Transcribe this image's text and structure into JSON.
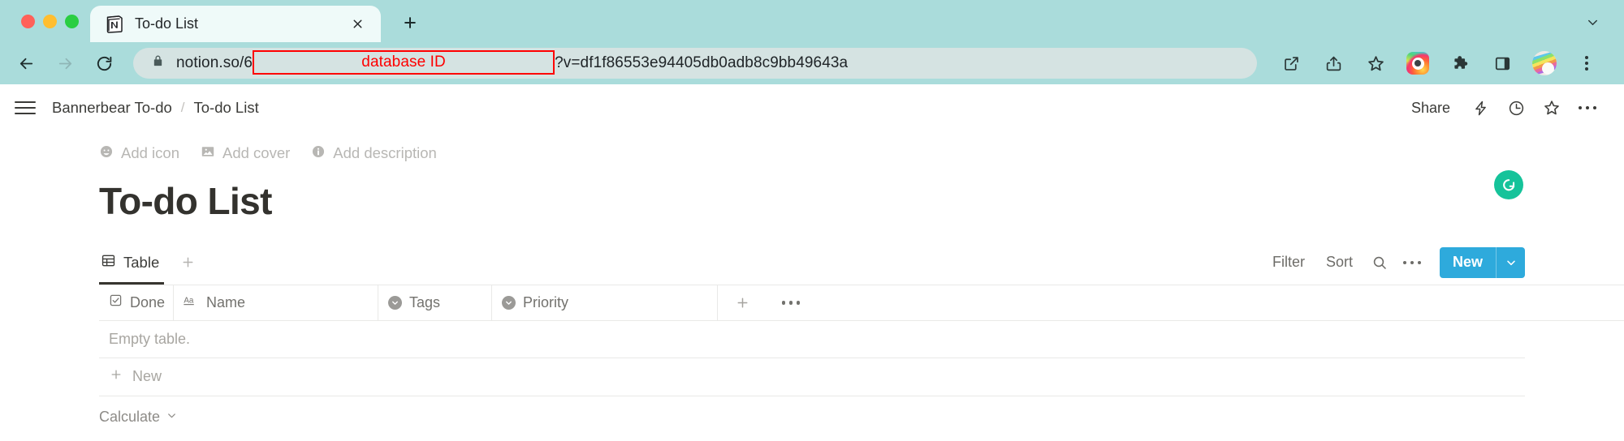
{
  "browser": {
    "tab": {
      "title": "To-do List",
      "favicon": "notion-icon",
      "close": "close-icon"
    },
    "new_tab": "new-tab-icon",
    "tab_list_chevron": "chevron-down-icon",
    "nav": {
      "back": "back-arrow-icon",
      "forward": "forward-arrow-icon",
      "reload": "reload-icon"
    },
    "omnibox": {
      "lock": "lock-icon",
      "url_prefix": "notion.so/6",
      "annotation": "database ID",
      "url_suffix": "?v=df1f86553e94405db0adb8c9bb49643a"
    },
    "toolbar_icons": [
      "open-external-icon",
      "share-icon",
      "bookmark-star-icon",
      "instagram-extension-icon",
      "extensions-puzzle-icon",
      "side-panel-icon",
      "profile-avatar-icon",
      "chrome-menu-icon"
    ],
    "colors": {
      "chrome_bg": "#aadcdb",
      "tab_bg": "#effaf9",
      "omnibox_bg": "#d5e3e2"
    }
  },
  "notion": {
    "menu_icon": "hamburger-icon",
    "breadcrumb": {
      "workspace": "Bannerbear To-do",
      "separator": "/",
      "page": "To-do List"
    },
    "topbar_right": {
      "share_label": "Share",
      "icons": [
        "lightning-bolt-icon",
        "page-history-clock-icon",
        "favorite-star-icon",
        "more-options-icon"
      ]
    },
    "page_options": [
      {
        "icon": "emoji-smiley-icon",
        "label": "Add icon"
      },
      {
        "icon": "image-icon",
        "label": "Add cover"
      },
      {
        "icon": "info-icon",
        "label": "Add description"
      }
    ],
    "title": "To-do List",
    "grammarly": {
      "icon": "grammarly-icon",
      "letter": "G",
      "color": "#15c39a"
    },
    "views": {
      "tabs": [
        {
          "icon": "table-view-icon",
          "label": "Table",
          "active": true
        }
      ],
      "add_view": "plus-icon",
      "controls": {
        "filter_label": "Filter",
        "sort_label": "Sort",
        "search_icon": "search-icon",
        "more_icon": "more-options-icon",
        "new_label": "New",
        "new_caret": "chevron-down-icon",
        "new_color": "#2eaadc"
      }
    },
    "table": {
      "columns": [
        {
          "icon": "checkbox-icon",
          "label": "Done"
        },
        {
          "icon": "text-aa-icon",
          "label": "Name"
        },
        {
          "icon": "select-icon",
          "label": "Tags"
        },
        {
          "icon": "select-icon",
          "label": "Priority"
        }
      ],
      "add_column_icon": "plus-icon",
      "column_options_icon": "more-options-icon",
      "empty_text": "Empty table.",
      "new_row_label": "New",
      "new_row_icon": "plus-icon",
      "calculate_label": "Calculate",
      "calculate_caret": "chevron-down-icon"
    }
  }
}
